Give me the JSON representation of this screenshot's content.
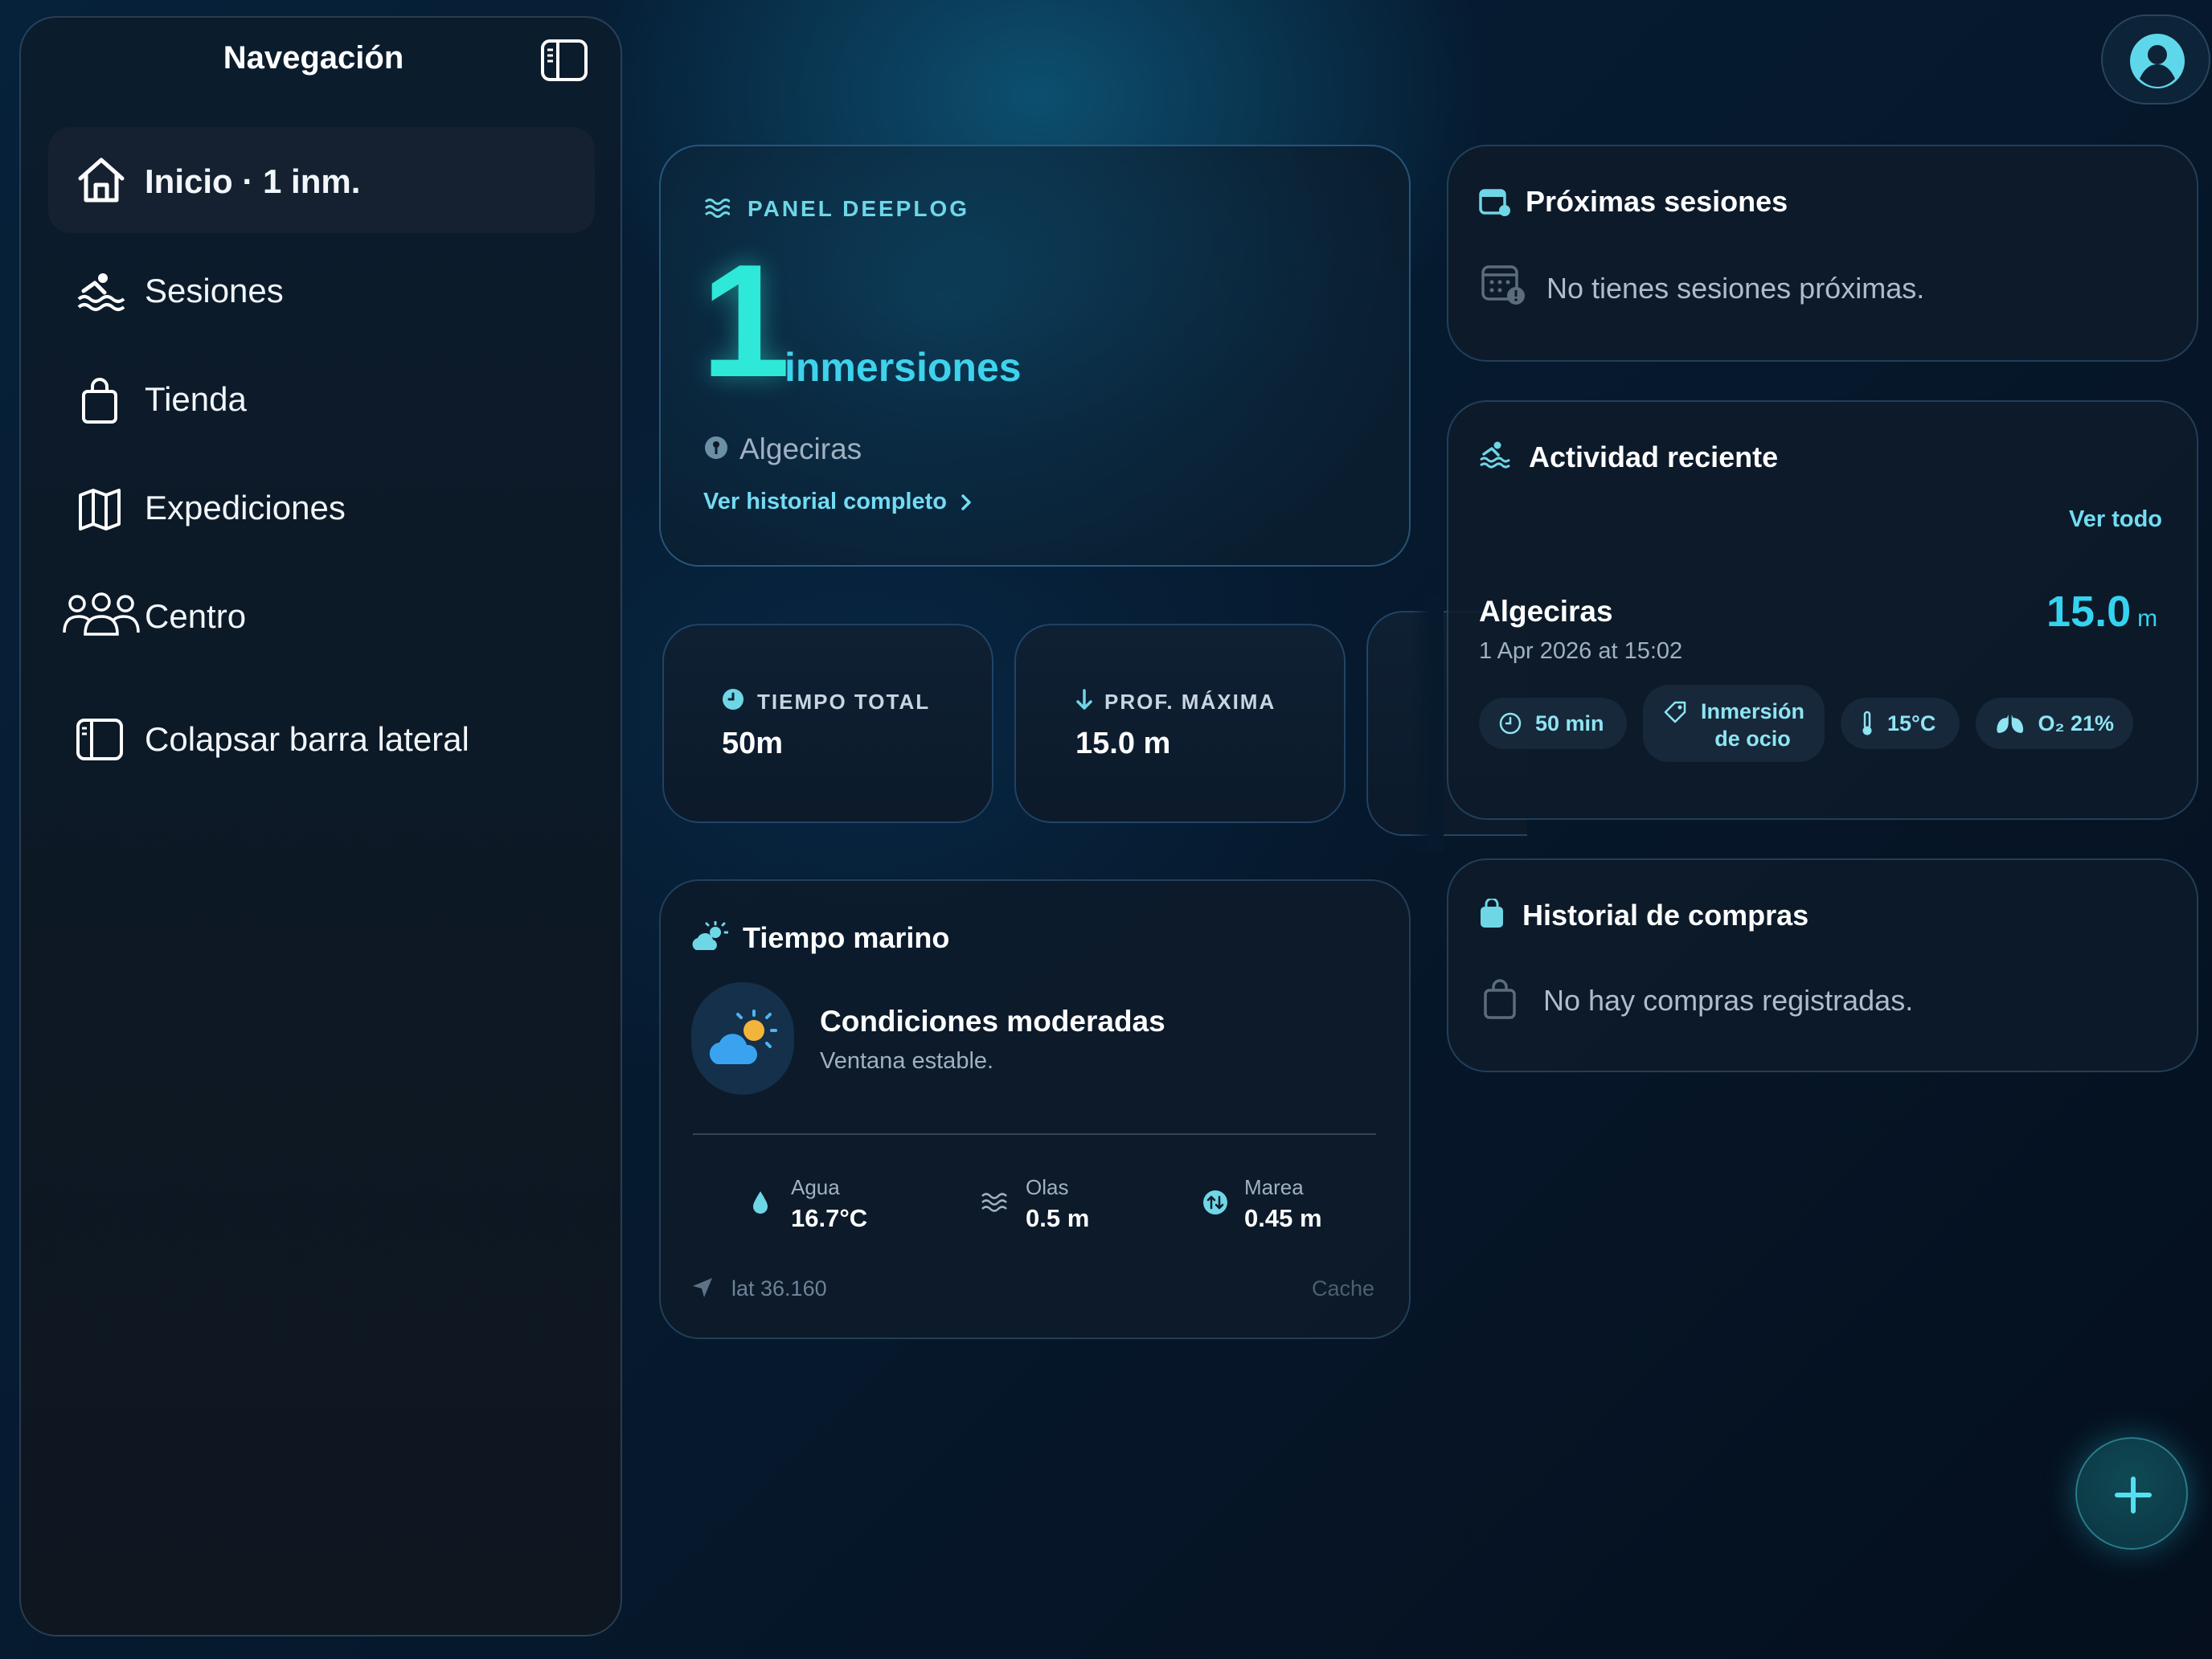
{
  "sidebar": {
    "title": "Navegación",
    "items": [
      {
        "label": "Inicio · 1 inm.",
        "icon": "house-icon",
        "active": true
      },
      {
        "label": "Sesiones",
        "icon": "swimmer-icon",
        "active": false
      },
      {
        "label": "Tienda",
        "icon": "bag-icon",
        "active": false
      },
      {
        "label": "Expediciones",
        "icon": "map-icon",
        "active": false
      },
      {
        "label": "Centro",
        "icon": "people-icon",
        "active": false
      },
      {
        "label": "Colapsar barra lateral",
        "icon": "sidebar-icon",
        "active": false
      }
    ]
  },
  "hero": {
    "eyebrow": "PANEL DEEPLOG",
    "count": "1",
    "unit": "inmersiones",
    "location": "Algeciras",
    "link": "Ver historial completo"
  },
  "stats": [
    {
      "label": "TIEMPO TOTAL",
      "value": "50m",
      "icon": "clock-icon"
    },
    {
      "label": "PROF. MÁXIMA",
      "value": "15.0 m",
      "icon": "arrow-down-icon"
    }
  ],
  "weather": {
    "title": "Tiempo marino",
    "condition": "Condiciones moderadas",
    "subtitle": "Ventana estable.",
    "metrics": [
      {
        "label": "Agua",
        "value": "16.7°C",
        "icon": "droplet-icon"
      },
      {
        "label": "Olas",
        "value": "0.5 m",
        "icon": "waves-icon"
      },
      {
        "label": "Marea",
        "value": "0.45 m",
        "icon": "tide-icon"
      }
    ],
    "coords": "lat 36.160",
    "source": "Cache"
  },
  "upcoming": {
    "title": "Próximas sesiones",
    "empty": "No tienes sesiones próximas."
  },
  "activity": {
    "title": "Actividad reciente",
    "see_all": "Ver todo",
    "item": {
      "place": "Algeciras",
      "date": "1 Apr 2026 at 15:02",
      "depth": "15.0",
      "depth_unit": "m",
      "duration": "50 min",
      "type_line1": "Inmersión",
      "type_line2": "de ocio",
      "temp": "15°C",
      "o2": "O₂ 21%"
    }
  },
  "purchases": {
    "title": "Historial de compras",
    "empty": "No hay compras registradas."
  },
  "colors": {
    "accent": "#2ee8d8",
    "link": "#72dcf3",
    "card_bg": "#0d1b2a"
  }
}
